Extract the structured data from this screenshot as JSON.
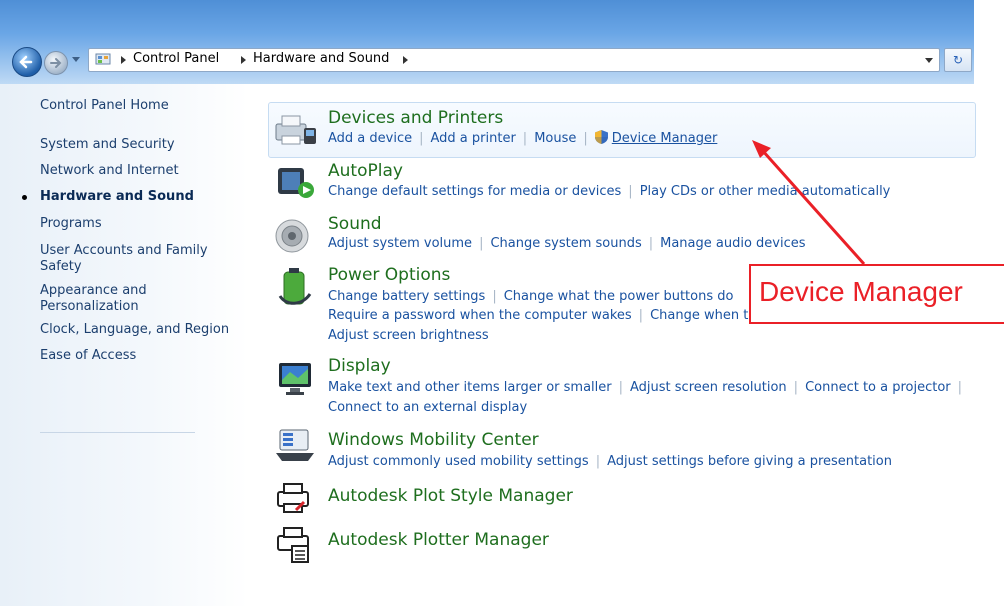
{
  "address_bar": {
    "crumbs": [
      "Control Panel",
      "Hardware and Sound"
    ]
  },
  "sidebar": {
    "items": [
      {
        "label": "Control Panel Home",
        "active": false
      },
      {
        "label": "System and Security",
        "active": false
      },
      {
        "label": "Network and Internet",
        "active": false
      },
      {
        "label": "Hardware and Sound",
        "active": true
      },
      {
        "label": "Programs",
        "active": false
      },
      {
        "label": "User Accounts and Family Safety",
        "active": false
      },
      {
        "label": "Appearance and Personalization",
        "active": false
      },
      {
        "label": "Clock, Language, and Region",
        "active": false
      },
      {
        "label": "Ease of Access",
        "active": false
      }
    ]
  },
  "categories": [
    {
      "title": "Devices and Printers",
      "icon": "printer-icon",
      "links": [
        "Add a device",
        "Add a printer",
        "Mouse",
        "Device Manager"
      ]
    },
    {
      "title": "AutoPlay",
      "icon": "autoplay-icon",
      "links": [
        "Change default settings for media or devices",
        "Play CDs or other media automatically"
      ]
    },
    {
      "title": "Sound",
      "icon": "speaker-icon",
      "links": [
        "Adjust system volume",
        "Change system sounds",
        "Manage audio devices"
      ]
    },
    {
      "title": "Power Options",
      "icon": "battery-icon",
      "links": [
        "Change battery settings",
        "Change what the power buttons do",
        "Require a password when the computer wakes",
        "Change when t",
        "Adjust screen brightness"
      ]
    },
    {
      "title": "Display",
      "icon": "monitor-icon",
      "links": [
        "Make text and other items larger or smaller",
        "Adjust screen resolution",
        "Connect to a projector",
        "Connect to an external display"
      ]
    },
    {
      "title": "Windows Mobility Center",
      "icon": "mobility-center-icon",
      "links": [
        "Adjust commonly used mobility settings",
        "Adjust settings before giving a presentation"
      ]
    },
    {
      "title": "Autodesk Plot Style Manager",
      "icon": "plotter-icon",
      "links": []
    },
    {
      "title": "Autodesk Plotter Manager",
      "icon": "plotter-manager-icon",
      "links": []
    }
  ],
  "annotation": {
    "callout_text": "Device Manager",
    "color": "#ea2027"
  },
  "colors": {
    "category_title": "#1e6e1e",
    "link": "#1a52a0",
    "titlebar": "#5b9ae0"
  }
}
